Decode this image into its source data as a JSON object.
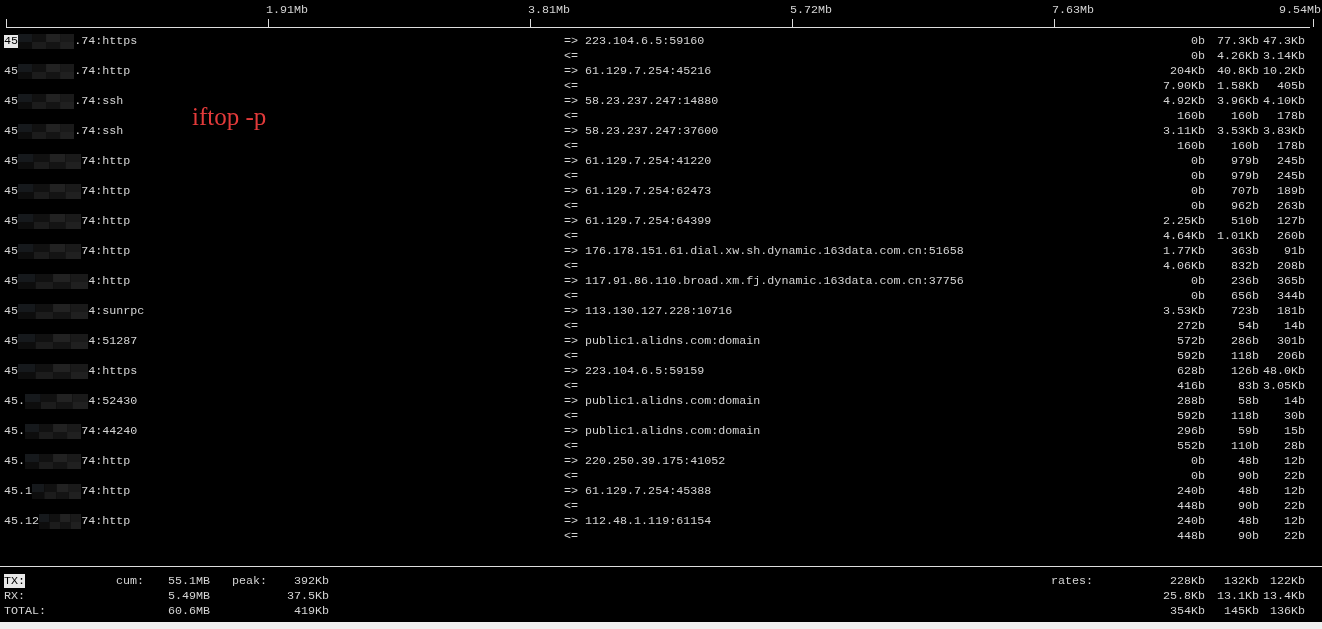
{
  "scale": [
    "1.91Mb",
    "3.81Mb",
    "5.72Mb",
    "7.63Mb",
    "9.54Mb"
  ],
  "annotation": "iftop -p",
  "connections": [
    {
      "cursor": true,
      "local_start": "45",
      "local_end": ".74:https",
      "out_arrow": "=>",
      "remote": "223.104.6.5:59160",
      "sent": [
        "0b",
        "77.3Kb",
        "47.3Kb"
      ],
      "in_arrow": "<=",
      "received": [
        "0b",
        "4.26Kb",
        "3.14Kb"
      ]
    },
    {
      "cursor": false,
      "local_start": "45",
      "local_end": ".74:http",
      "out_arrow": "=>",
      "remote": "61.129.7.254:45216",
      "sent": [
        "204Kb",
        "40.8Kb",
        "10.2Kb"
      ],
      "in_arrow": "<=",
      "received": [
        "7.90Kb",
        "1.58Kb",
        "405b"
      ]
    },
    {
      "cursor": false,
      "local_start": "45",
      "local_end": ".74:ssh",
      "out_arrow": "=>",
      "remote": "58.23.237.247:14880",
      "sent": [
        "4.92Kb",
        "3.96Kb",
        "4.10Kb"
      ],
      "in_arrow": "<=",
      "received": [
        "160b",
        "160b",
        "178b"
      ]
    },
    {
      "cursor": false,
      "local_start": "45",
      "local_end": ".74:ssh",
      "out_arrow": "=>",
      "remote": "58.23.237.247:37600",
      "sent": [
        "3.11Kb",
        "3.53Kb",
        "3.83Kb"
      ],
      "in_arrow": "<=",
      "received": [
        "160b",
        "160b",
        "178b"
      ]
    },
    {
      "cursor": false,
      "local_start": "45",
      "local_end": "74:http",
      "out_arrow": "=>",
      "remote": "61.129.7.254:41220",
      "sent": [
        "0b",
        "979b",
        "245b"
      ],
      "in_arrow": "<=",
      "received": [
        "0b",
        "979b",
        "245b"
      ]
    },
    {
      "cursor": false,
      "local_start": "45",
      "local_end": "74:http",
      "out_arrow": "=>",
      "remote": "61.129.7.254:62473",
      "sent": [
        "0b",
        "707b",
        "189b"
      ],
      "in_arrow": "<=",
      "received": [
        "0b",
        "962b",
        "263b"
      ]
    },
    {
      "cursor": false,
      "local_start": "45",
      "local_end": "74:http",
      "out_arrow": "=>",
      "remote": "61.129.7.254:64399",
      "sent": [
        "2.25Kb",
        "510b",
        "127b"
      ],
      "in_arrow": "<=",
      "received": [
        "4.64Kb",
        "1.01Kb",
        "260b"
      ]
    },
    {
      "cursor": false,
      "local_start": "45",
      "local_end": "74:http",
      "out_arrow": "=>",
      "remote": "176.178.151.61.dial.xw.sh.dynamic.163data.com.cn:51658",
      "sent": [
        "1.77Kb",
        "363b",
        "91b"
      ],
      "in_arrow": "<=",
      "received": [
        "4.06Kb",
        "832b",
        "208b"
      ]
    },
    {
      "cursor": false,
      "local_start": "45",
      "local_end": "4:http",
      "out_arrow": "=>",
      "remote": "117.91.86.110.broad.xm.fj.dynamic.163data.com.cn:37756",
      "sent": [
        "0b",
        "236b",
        "365b"
      ],
      "in_arrow": "<=",
      "received": [
        "0b",
        "656b",
        "344b"
      ]
    },
    {
      "cursor": false,
      "local_start": "45",
      "local_end": "4:sunrpc",
      "out_arrow": "=>",
      "remote": "113.130.127.228:10716",
      "sent": [
        "3.53Kb",
        "723b",
        "181b"
      ],
      "in_arrow": "<=",
      "received": [
        "272b",
        "54b",
        "14b"
      ]
    },
    {
      "cursor": false,
      "local_start": "45",
      "local_end": "4:51287",
      "out_arrow": "=>",
      "remote": "public1.alidns.com:domain",
      "sent": [
        "572b",
        "286b",
        "301b"
      ],
      "in_arrow": "<=",
      "received": [
        "592b",
        "118b",
        "206b"
      ]
    },
    {
      "cursor": false,
      "local_start": "45",
      "local_end": "4:https",
      "out_arrow": "=>",
      "remote": "223.104.6.5:59159",
      "sent": [
        "628b",
        "126b",
        "48.0Kb"
      ],
      "in_arrow": "<=",
      "received": [
        "416b",
        "83b",
        "3.05Kb"
      ]
    },
    {
      "cursor": false,
      "local_start": "45.",
      "local_end": "4:52430",
      "out_arrow": "=>",
      "remote": "public1.alidns.com:domain",
      "sent": [
        "288b",
        "58b",
        "14b"
      ],
      "in_arrow": "<=",
      "received": [
        "592b",
        "118b",
        "30b"
      ]
    },
    {
      "cursor": false,
      "local_start": "45.",
      "local_end": "74:44240",
      "out_arrow": "=>",
      "remote": "public1.alidns.com:domain",
      "sent": [
        "296b",
        "59b",
        "15b"
      ],
      "in_arrow": "<=",
      "received": [
        "552b",
        "110b",
        "28b"
      ]
    },
    {
      "cursor": false,
      "local_start": "45.",
      "local_end": "74:http",
      "out_arrow": "=>",
      "remote": "220.250.39.175:41052",
      "sent": [
        "0b",
        "48b",
        "12b"
      ],
      "in_arrow": "<=",
      "received": [
        "0b",
        "90b",
        "22b"
      ]
    },
    {
      "cursor": false,
      "local_start": "45.1",
      "local_end": "74:http",
      "out_arrow": "=>",
      "remote": "61.129.7.254:45388",
      "sent": [
        "240b",
        "48b",
        "12b"
      ],
      "in_arrow": "<=",
      "received": [
        "448b",
        "90b",
        "22b"
      ]
    },
    {
      "cursor": false,
      "local_start": "45.12",
      "local_end": "74:http",
      "out_arrow": "=>",
      "remote": "112.48.1.119:61154",
      "sent": [
        "240b",
        "48b",
        "12b"
      ],
      "in_arrow": "<=",
      "received": [
        "448b",
        "90b",
        "22b"
      ]
    }
  ],
  "totals": [
    {
      "label": "TX:",
      "cursor": true,
      "cum_label": "cum:",
      "cum": "55.1MB",
      "peak_label": "peak:",
      "peak": "392Kb",
      "rates_label": "rates:",
      "rates": [
        "228Kb",
        "132Kb",
        "122Kb"
      ]
    },
    {
      "label": "RX:",
      "cursor": false,
      "cum": "5.49MB",
      "peak": "37.5Kb",
      "rates": [
        "25.8Kb",
        "13.1Kb",
        "13.4Kb"
      ]
    },
    {
      "label": "TOTAL:",
      "cursor": false,
      "cum": "60.6MB",
      "peak": "419Kb",
      "rates": [
        "354Kb",
        "145Kb",
        "136Kb"
      ]
    }
  ]
}
